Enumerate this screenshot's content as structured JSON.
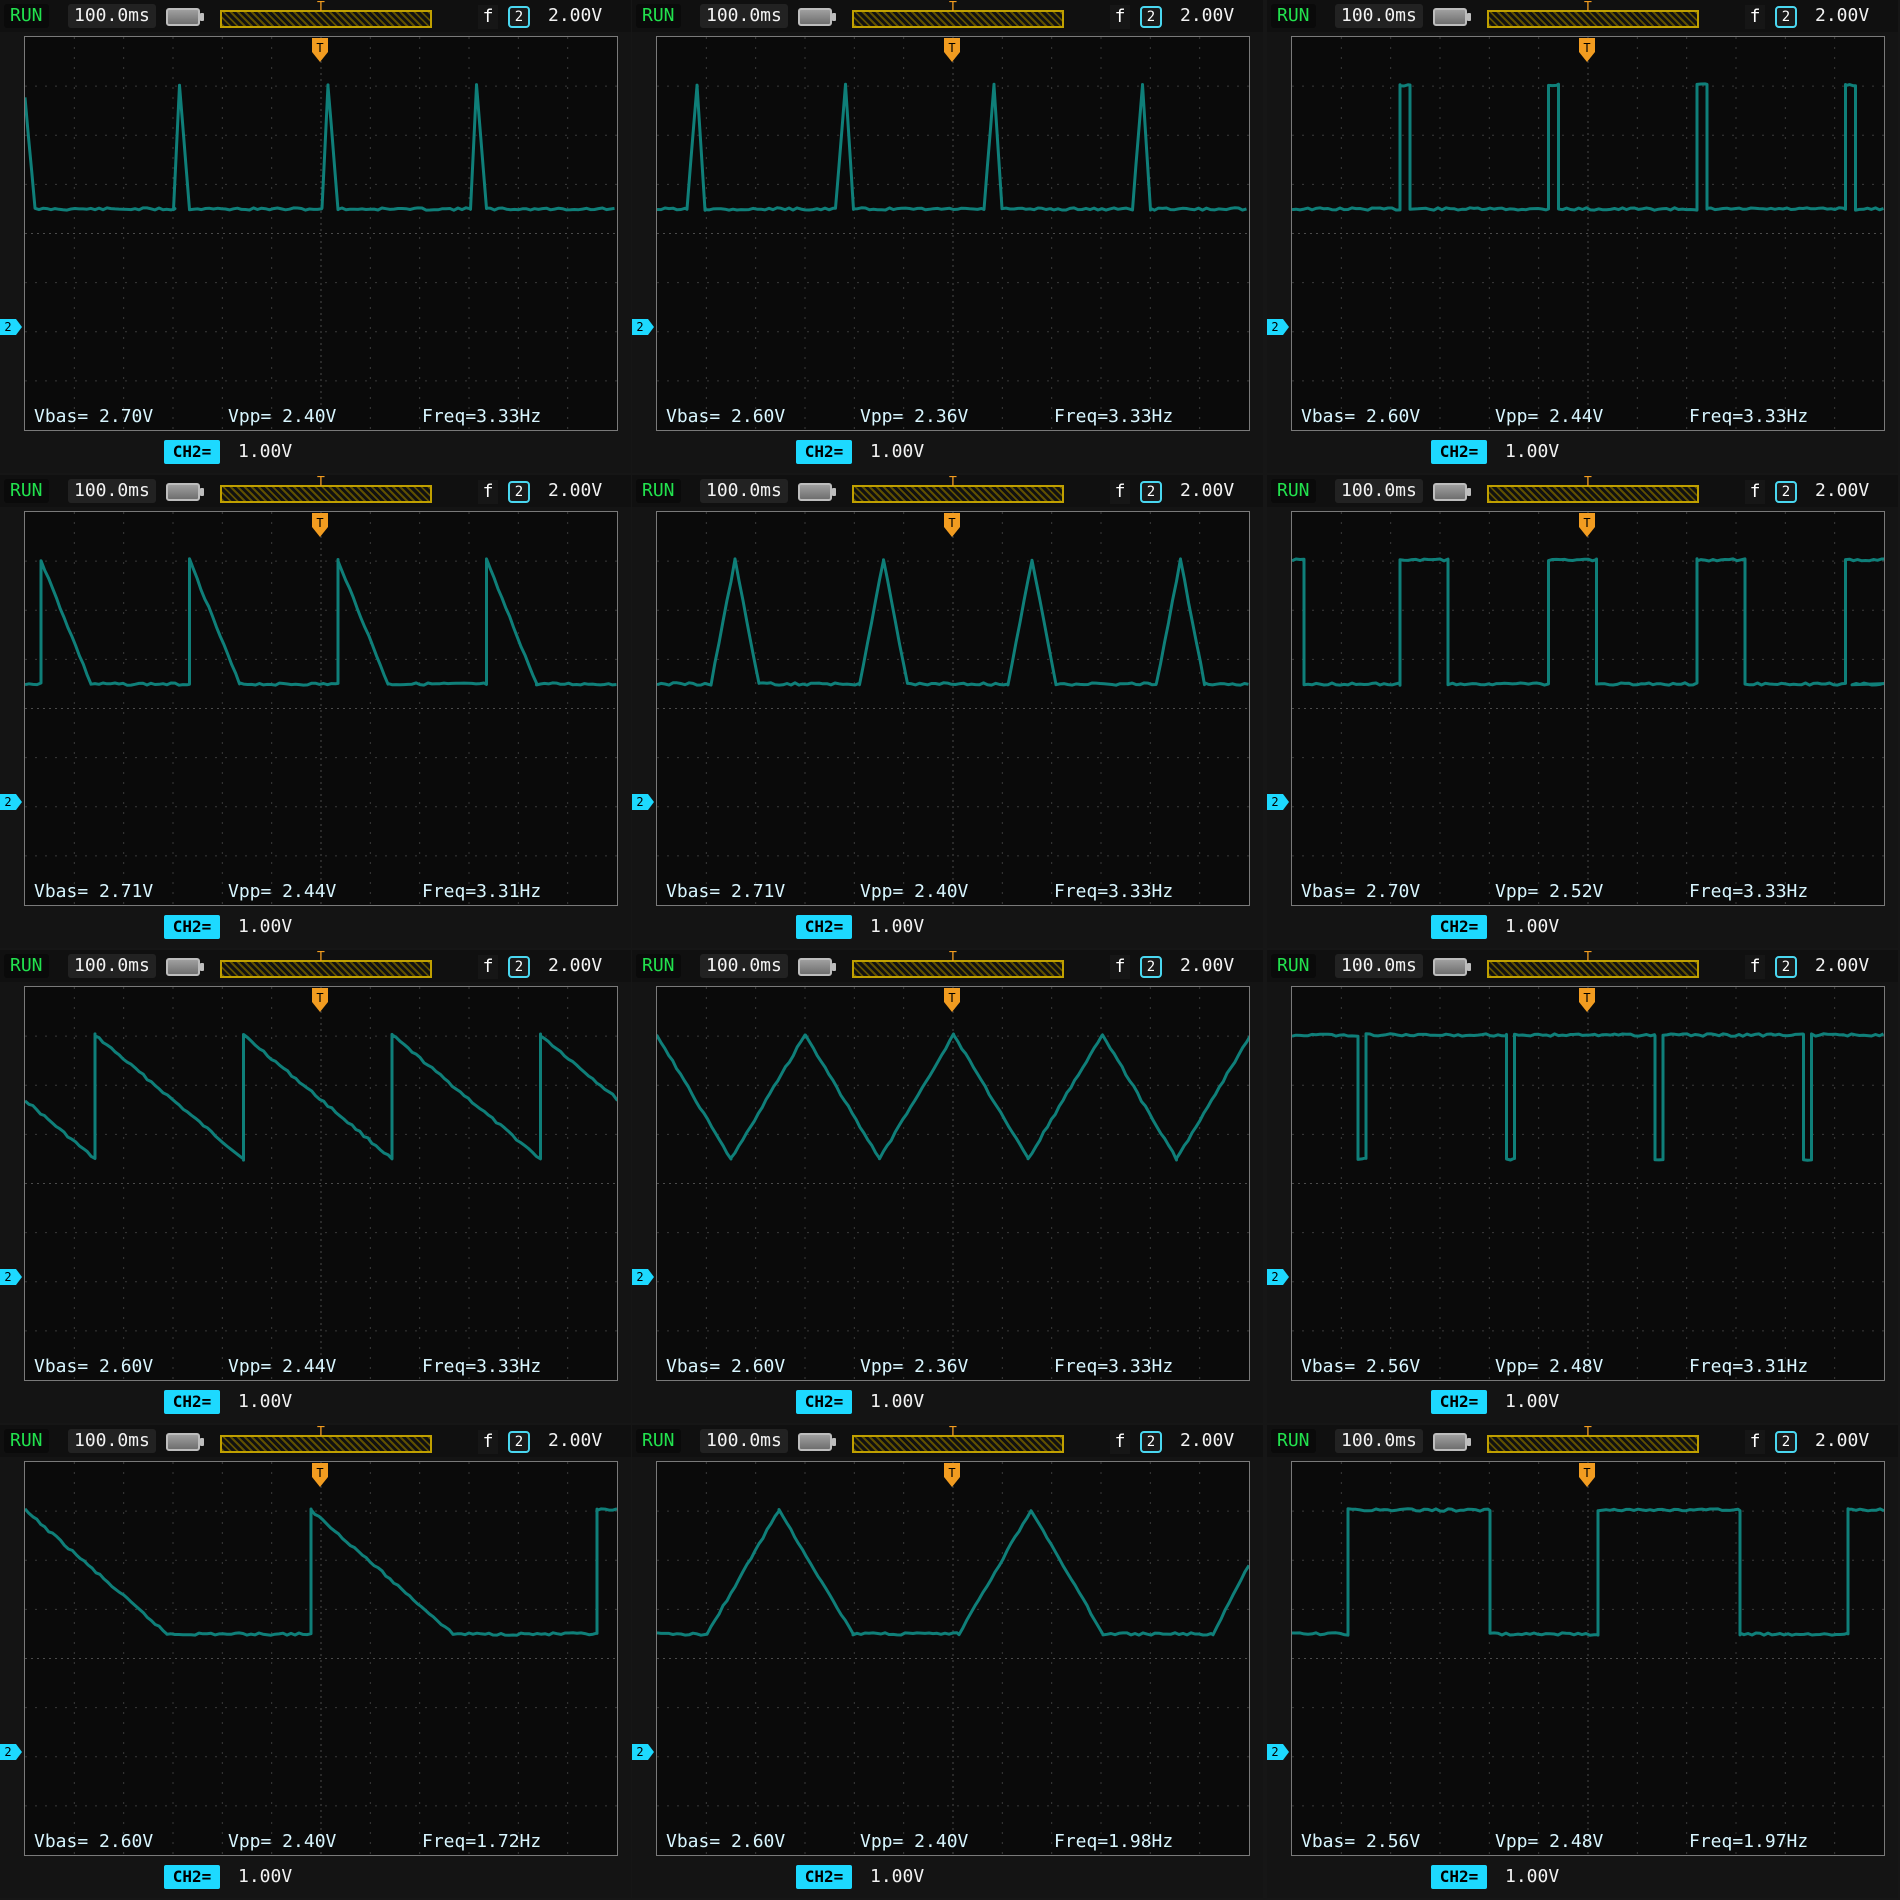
{
  "global": {
    "status": "RUN",
    "timebase": "100.0ms",
    "trigger_channel": "2",
    "trigger_level": "2.00V",
    "channel_badge": "CH2=",
    "channel_scale": "1.00V",
    "marker_t": "T",
    "marker_2": "2",
    "trigger_slope_symbol": "f"
  },
  "panels": [
    {
      "vbas": "Vbas= 2.70V",
      "vpp": "Vpp= 2.40V",
      "freq": "Freq=3.33Hz",
      "waveform": "spike-narrow-left"
    },
    {
      "vbas": "Vbas= 2.60V",
      "vpp": "Vpp= 2.36V",
      "freq": "Freq=3.33Hz",
      "waveform": "spike-narrow"
    },
    {
      "vbas": "Vbas= 2.60V",
      "vpp": "Vpp= 2.44V",
      "freq": "Freq=3.33Hz",
      "waveform": "pulse-narrow"
    },
    {
      "vbas": "Vbas= 2.71V",
      "vpp": "Vpp= 2.44V",
      "freq": "Freq=3.31Hz",
      "waveform": "ramp-down-bumps"
    },
    {
      "vbas": "Vbas= 2.71V",
      "vpp": "Vpp= 2.40V",
      "freq": "Freq=3.33Hz",
      "waveform": "triangle-peaks"
    },
    {
      "vbas": "Vbas= 2.70V",
      "vpp": "Vpp= 2.52V",
      "freq": "Freq=3.33Hz",
      "waveform": "square-pulses"
    },
    {
      "vbas": "Vbas= 2.60V",
      "vpp": "Vpp= 2.44V",
      "freq": "Freq=3.33Hz",
      "waveform": "sawtooth"
    },
    {
      "vbas": "Vbas= 2.60V",
      "vpp": "Vpp= 2.36V",
      "freq": "Freq=3.33Hz",
      "waveform": "triangle"
    },
    {
      "vbas": "Vbas= 2.56V",
      "vpp": "Vpp= 2.48V",
      "freq": "Freq=3.31Hz",
      "waveform": "negative-pulses"
    },
    {
      "vbas": "Vbas= 2.60V",
      "vpp": "Vpp= 2.40V",
      "freq": "Freq=1.72Hz",
      "waveform": "ramp-down-long"
    },
    {
      "vbas": "Vbas= 2.60V",
      "vpp": "Vpp= 2.40V",
      "freq": "Freq=1.98Hz",
      "waveform": "triangle-plateau"
    },
    {
      "vbas": "Vbas= 2.56V",
      "vpp": "Vpp= 2.48V",
      "freq": "Freq=1.97Hz",
      "waveform": "square-wide"
    }
  ]
}
